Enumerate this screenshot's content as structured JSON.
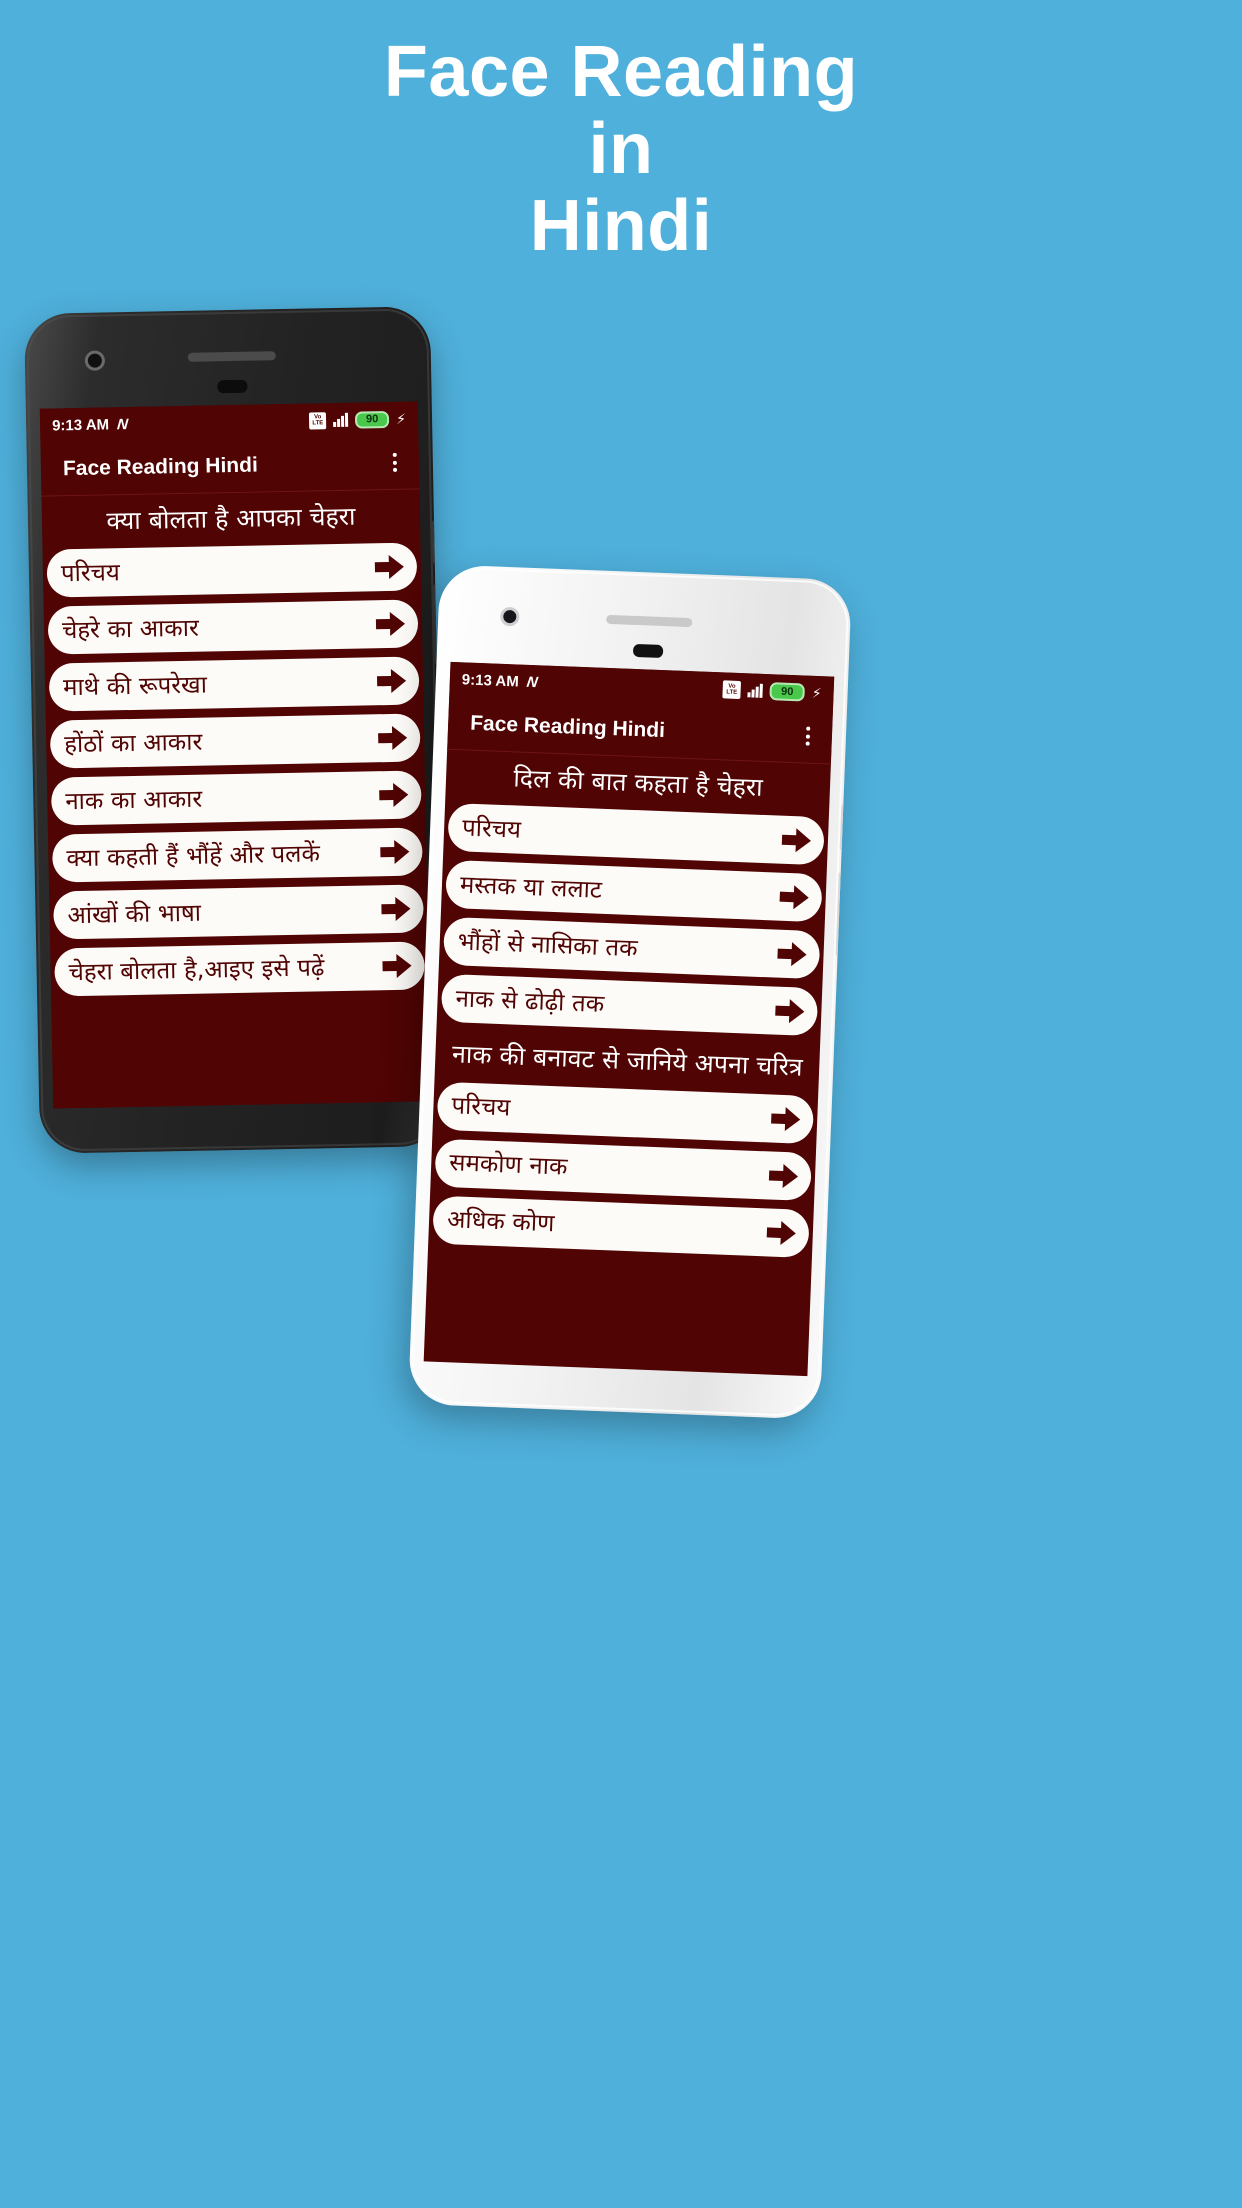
{
  "promo": {
    "line1": "Face Reading",
    "line2": "in",
    "line3": "Hindi",
    "background_color": "#4fb0db",
    "text_color": "#ffffff"
  },
  "theme": {
    "app_primary": "#500404",
    "pill_background": "#fdfbf7",
    "pill_text": "#500404",
    "battery_green": "#49c84b"
  },
  "status_bar": {
    "time": "9:13 AM",
    "nfc_icon": "N",
    "volte_top": "Vo",
    "volte_bottom": "LTE",
    "signal_icon": "signal-bars",
    "battery_level": "90",
    "charging_icon": "⚡"
  },
  "app_bar": {
    "title": "Face Reading Hindi",
    "overflow_icon": "kebab-menu"
  },
  "phone_left": {
    "sections": [
      {
        "heading": "क्या बोलता है आपका चेहरा",
        "items": [
          "परिचय",
          "चेहरे का आकार",
          "माथे की रूपरेखा",
          "होंठों का आकार",
          "नाक का आकार",
          "क्या कहती हैं भौंहें और पलकें",
          "आंखों की भाषा",
          "चेहरा बोलता है,आइए इसे पढ़ें"
        ]
      }
    ]
  },
  "phone_right": {
    "sections": [
      {
        "heading": "दिल की बात कहता है चेहरा",
        "items": [
          "परिचय",
          "मस्तक या ललाट",
          "भौंहों से नासिका तक",
          "नाक से ढोढ़ी तक"
        ]
      },
      {
        "heading": "नाक की बनावट से जानिये अपना चरित्र",
        "items": [
          "परिचय",
          "समकोण नाक",
          "अधिक कोण"
        ]
      }
    ]
  }
}
